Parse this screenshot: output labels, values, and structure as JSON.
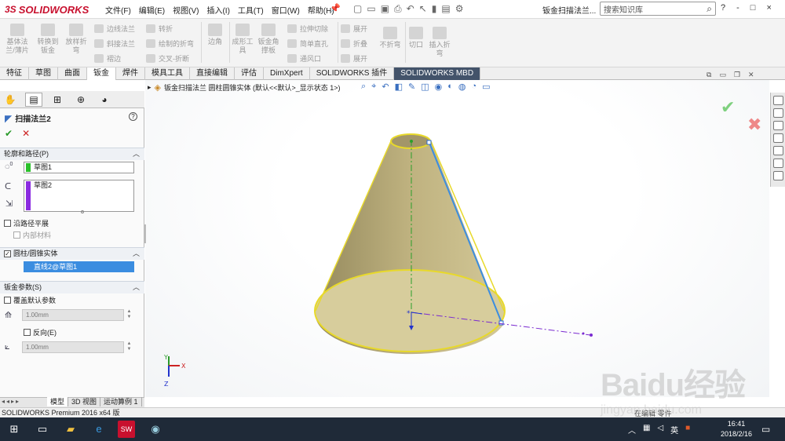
{
  "app": {
    "logo_text": "SOLIDWORKS",
    "logo_ds": "3S",
    "doc_title": "钣金扫描法兰..."
  },
  "menu": [
    "文件(F)",
    "编辑(E)",
    "视图(V)",
    "插入(I)",
    "工具(T)",
    "窗口(W)",
    "帮助(H)"
  ],
  "search": {
    "placeholder": "搜索知识库"
  },
  "window_controls": [
    "?",
    "-",
    "□",
    "×"
  ],
  "ribbon": {
    "large": [
      "基体法兰/薄片",
      "转换到钣金",
      "放样折弯",
      "边角",
      "成形工具",
      "钣金角撑板",
      "不折弯",
      "切口",
      "插入折弯"
    ],
    "small": [
      "边线法兰",
      "斜接法兰",
      "褶边",
      "转折",
      "绘制的折弯",
      "交叉-折断",
      "拉伸切除",
      "简单直孔",
      "通风口",
      "展开",
      "折叠",
      "展开"
    ]
  },
  "tabs": [
    "特征",
    "草图",
    "曲面",
    "钣金",
    "焊件",
    "模具工具",
    "直接编辑",
    "评估",
    "DimXpert",
    "SOLIDWORKS 插件",
    "SOLIDWORKS MBD"
  ],
  "active_tab": "钣金",
  "feature": {
    "title": "扫描法兰2",
    "ok": "✔",
    "cancel": "✕"
  },
  "sections": {
    "profile_path": {
      "title": "轮廓和路径(P)",
      "profile": "草图1",
      "path": "草图2",
      "profile_label": "0"
    },
    "flatten": {
      "label": "沿路径平展",
      "material": "内部材料"
    },
    "cylinder": {
      "title": "圆柱/圆锥实体",
      "value": "直线2@草图1"
    },
    "sheetmetal": {
      "title": "钣金参数(S)",
      "override": "覆盖默认参数",
      "thickness": "1.00mm",
      "reverse": "反向(E)",
      "radius": "1.00mm"
    }
  },
  "viewport": {
    "breadcrumb": "钣金扫描法兰 圆柱圆锥实体 (默认<<默认>_显示状态 1>)"
  },
  "axes": {
    "x": "X",
    "y": "Y",
    "z": "Z"
  },
  "bottom_tabs": [
    "模型",
    "3D 视图",
    "运动算例 1"
  ],
  "status": {
    "left": "SOLIDWORKS Premium 2016 x64 版",
    "right": "在编辑 零件"
  },
  "taskbar": {
    "time": "16:41",
    "date": "2018/2/16",
    "lang": "英"
  },
  "watermark": {
    "text": "Baidu经验",
    "url": "jingyan.baidu.com"
  },
  "colors": {
    "cone": "#b5a770",
    "cone_edge": "#e8d92a",
    "path": "#7a2ad0",
    "line": "#3b8de0",
    "brand": "#c8102e"
  }
}
